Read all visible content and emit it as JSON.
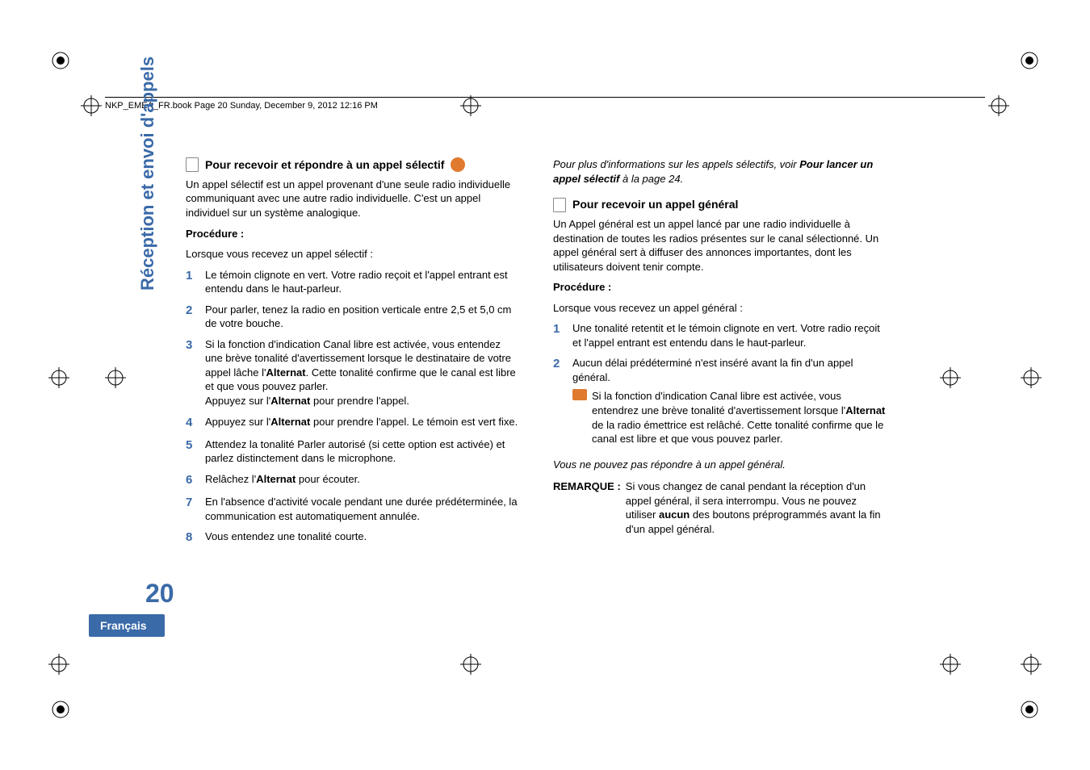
{
  "header": "NKP_EMEA_FR.book  Page 20  Sunday, December 9, 2012  12:16 PM",
  "side_tab": "Réception et envoi d'appels",
  "page_number": "20",
  "language": "Français",
  "left": {
    "title": "Pour recevoir et répondre à un appel sélectif",
    "intro": "Un appel sélectif est un appel provenant d'une seule radio individuelle communiquant avec une autre radio individuelle. C'est un appel individuel sur un système analogique.",
    "proc_label": "Procédure :",
    "proc_sub": "Lorsque vous recevez un appel sélectif :",
    "steps": {
      "1": "Le témoin clignote en vert. Votre radio reçoit et l'appel entrant est entendu dans le haut-parleur.",
      "2": "Pour parler, tenez la radio en position verticale entre 2,5 et 5,0 cm de votre bouche.",
      "3a": "Si la fonction d'indication Canal libre est activée, vous entendez une brève tonalité d'avertissement lorsque le destinataire de votre appel lâche l'",
      "3b": "Alternat",
      "3c": ". Cette tonalité confirme que le canal est libre et que vous pouvez parler.",
      "3d": "Appuyez sur l'",
      "3e": "Alternat",
      "3f": " pour prendre l'appel.",
      "4a": "Appuyez sur l'",
      "4b": "Alternat",
      "4c": " pour prendre l'appel. Le témoin est vert fixe.",
      "5": "Attendez la tonalité Parler autorisé (si cette option est activée) et parlez distinctement dans le microphone.",
      "6a": "Relâchez l'",
      "6b": "Alternat",
      "6c": " pour écouter.",
      "7": "En l'absence d'activité vocale pendant une durée prédéterminée, la communication est automatiquement annulée.",
      "8": "Vous entendez une tonalité courte."
    }
  },
  "right": {
    "cont_a": "Pour plus d'informations sur les appels sélectifs, voir ",
    "cont_b": "Pour lancer un appel sélectif",
    "cont_c": " à la page 24.",
    "title": "Pour recevoir un appel général",
    "intro": "Un Appel général est un appel lancé par une radio individuelle à destination de toutes les radios présentes sur le canal sélectionné. Un appel général sert à diffuser des annonces importantes, dont les utilisateurs doivent tenir compte.",
    "proc_label": "Procédure :",
    "proc_sub": "Lorsque vous recevez un appel général :",
    "steps": {
      "1": "Une tonalité retentit et le témoin clignote en vert. Votre radio reçoit et l'appel entrant est entendu dans le haut-parleur.",
      "2": "Aucun délai prédéterminé n'est inséré avant la fin d'un appel général."
    },
    "note_a": "Si la fonction d'indication Canal libre est activée, vous entendrez une brève tonalité d'avertissement lorsque l'",
    "note_b": "Alternat",
    "note_c": " de la radio émettrice est relâché. Cette tonalité confirme que le canal est libre et que vous pouvez parler.",
    "no_reply": "Vous ne pouvez pas répondre à un appel général.",
    "remark_label": "REMARQUE :",
    "remark_a": "Si vous changez de canal pendant la réception d'un appel général, il sera interrompu. Vous ne pouvez utiliser ",
    "remark_b": "aucun",
    "remark_c": " des boutons préprogrammés avant la fin d'un appel général."
  }
}
